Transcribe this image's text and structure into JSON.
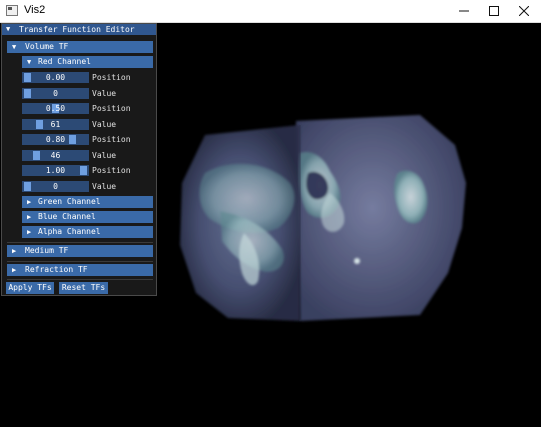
{
  "window": {
    "title": "Vis2"
  },
  "editor": {
    "title": "Transfer Function Editor",
    "volume_tf": {
      "label": "Volume TF",
      "red": {
        "label": "Red Channel",
        "rows": [
          {
            "value": "0.00",
            "label": "Position"
          },
          {
            "value": "0",
            "label": "Value"
          },
          {
            "value": "0.50",
            "label": "Position"
          },
          {
            "value": "61",
            "label": "Value"
          },
          {
            "value": "0.80",
            "label": "Position"
          },
          {
            "value": "46",
            "label": "Value"
          },
          {
            "value": "1.00",
            "label": "Position"
          },
          {
            "value": "0",
            "label": "Value"
          }
        ]
      },
      "green": {
        "label": "Green Channel"
      },
      "blue": {
        "label": "Blue Channel"
      },
      "alpha": {
        "label": "Alpha Channel"
      }
    },
    "medium_tf": {
      "label": "Medium TF"
    },
    "refraction_tf": {
      "label": "Refraction TF"
    },
    "apply_label": "Apply TFs",
    "reset_label": "Reset TFs"
  },
  "colors": {
    "title_active": "#30578f",
    "header": "#3a6aa8",
    "slider_bg": "#2c4a75",
    "slider_grab": "#6f9fe0",
    "volume_tint": "#8090b8"
  },
  "icons": {
    "app": "app-window-icon",
    "minimize": "minimize-icon",
    "maximize": "maximize-icon",
    "close": "close-icon",
    "collapse": "triangle-down-icon",
    "expand": "triangle-right-icon"
  }
}
